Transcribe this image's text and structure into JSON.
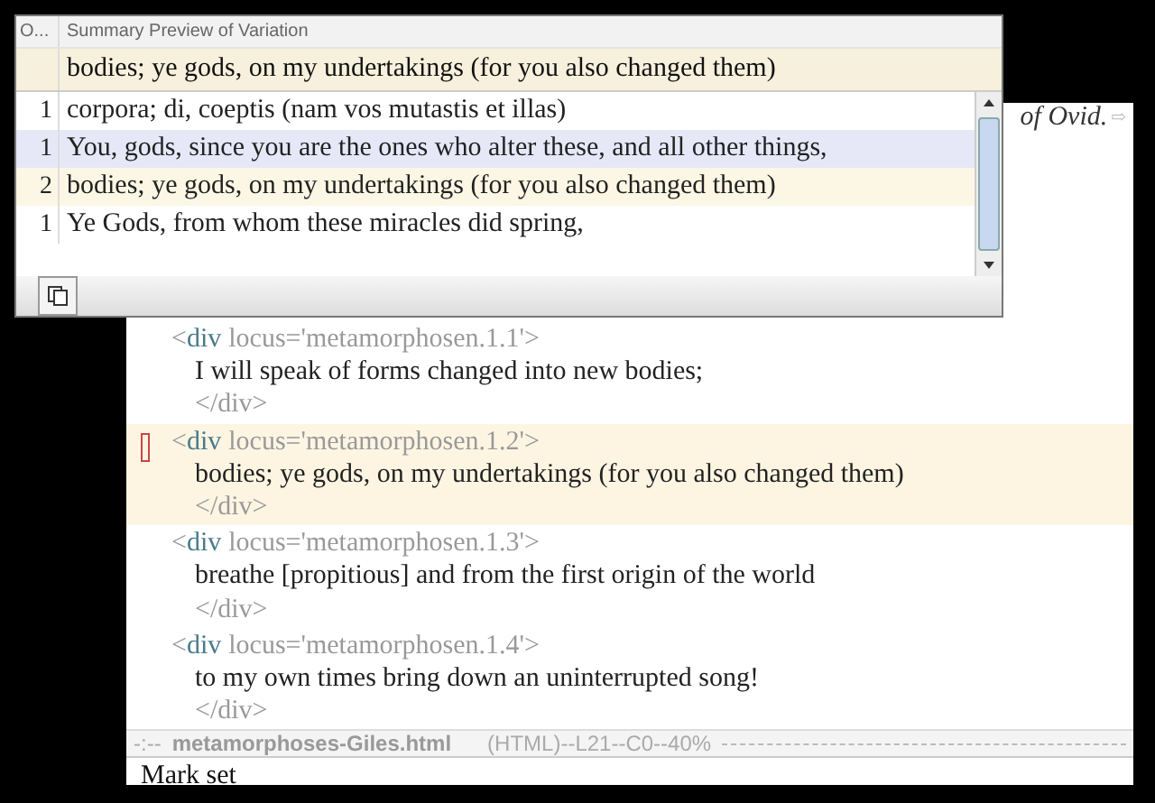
{
  "editor": {
    "top_line": "of Ovid.",
    "continuation": "⇨",
    "blocks": [
      {
        "current": false,
        "locus": "locus='metamorphosen.1.1'>",
        "tag": "div",
        "open": "<",
        "text": "I will speak of forms changed into new bodies;",
        "close": "</div>"
      },
      {
        "current": true,
        "locus": "locus='metamorphosen.1.2'>",
        "tag": "div",
        "open": "<",
        "text": "bodies; ye gods, on my undertakings (for you also changed them)",
        "close": "</div>"
      },
      {
        "current": false,
        "locus": "locus='metamorphosen.1.3'>",
        "tag": "div",
        "open": "<",
        "text": "breathe [propitious] and from the first origin of the world",
        "close": "</div>"
      },
      {
        "current": false,
        "locus": "locus='metamorphosen.1.4'>",
        "tag": "div",
        "open": "<",
        "text": "to my own times bring down an uninterrupted song!",
        "close": "</div>"
      }
    ],
    "mode_line": {
      "status": "-:--",
      "buffer": "metamorphoses-Giles.html",
      "info": "(HTML)--L21--C0--40%"
    },
    "minibuffer": "Mark set"
  },
  "popup": {
    "columns": [
      "O...",
      "Summary Preview of Variation"
    ],
    "pinned": "bodies; ye gods, on my undertakings (for you also changed them)",
    "rows": [
      {
        "count": "1",
        "text": "corpora; di, coeptis (nam vos mutastis et illas)",
        "selected": false,
        "highlighted": false
      },
      {
        "count": "1",
        "text": "You, gods, since you are the ones who alter these, and all other things,",
        "selected": true,
        "highlighted": false
      },
      {
        "count": "2",
        "text": "bodies; ye gods, on my undertakings (for you also changed them)",
        "selected": false,
        "highlighted": true
      },
      {
        "count": "1",
        "text": "Ye Gods, from whom these miracles did spring,",
        "selected": false,
        "highlighted": false
      }
    ]
  }
}
